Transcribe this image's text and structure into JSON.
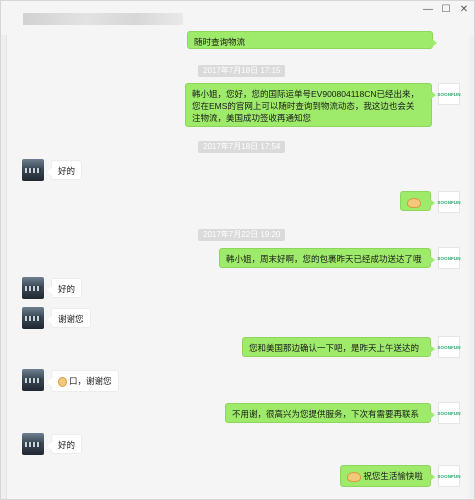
{
  "window": {
    "minimize_icon": "minimize-icon",
    "maximize_icon": "maximize-icon",
    "close_icon": "close-icon",
    "minimize": "—",
    "maximize": "☐",
    "close": "✕"
  },
  "brand_avatar_text": "SOONFUN",
  "timestamps": [
    "2017年7月18日 17:15",
    "2017年7月18日 17:54",
    "2017年7月22日 19:20"
  ],
  "messages": [
    {
      "from": "me",
      "text": "随时查询物流"
    },
    {
      "from": "me",
      "lines": [
        "韩小姐，您好，您的国际运单号EV900804118CN已经出来，",
        "您在EMS的官网上可以随时查询到物流动态，我这边也会关",
        "注物流，美国成功签收再通知您"
      ]
    },
    {
      "from": "them",
      "text": "好的"
    },
    {
      "from": "me",
      "emoji": "handshake-emoji"
    },
    {
      "from": "me",
      "text": "韩小姐，周末好啊，您的包裹昨天已经成功送达了哦"
    },
    {
      "from": "them",
      "text": "好的"
    },
    {
      "from": "them",
      "text": "谢谢您"
    },
    {
      "from": "me",
      "text": "您和美国那边确认一下吧，是昨天上午送达的"
    },
    {
      "from": "them",
      "text": "口，谢谢您",
      "emoji": "ok-hand-emoji"
    },
    {
      "from": "me",
      "text": "不用谢，很高兴为您提供服务，下次有需要再联系"
    },
    {
      "from": "them",
      "text": "好的"
    },
    {
      "from": "me",
      "text": "祝您生活愉快啦",
      "emoji": "handshake-emoji"
    }
  ]
}
